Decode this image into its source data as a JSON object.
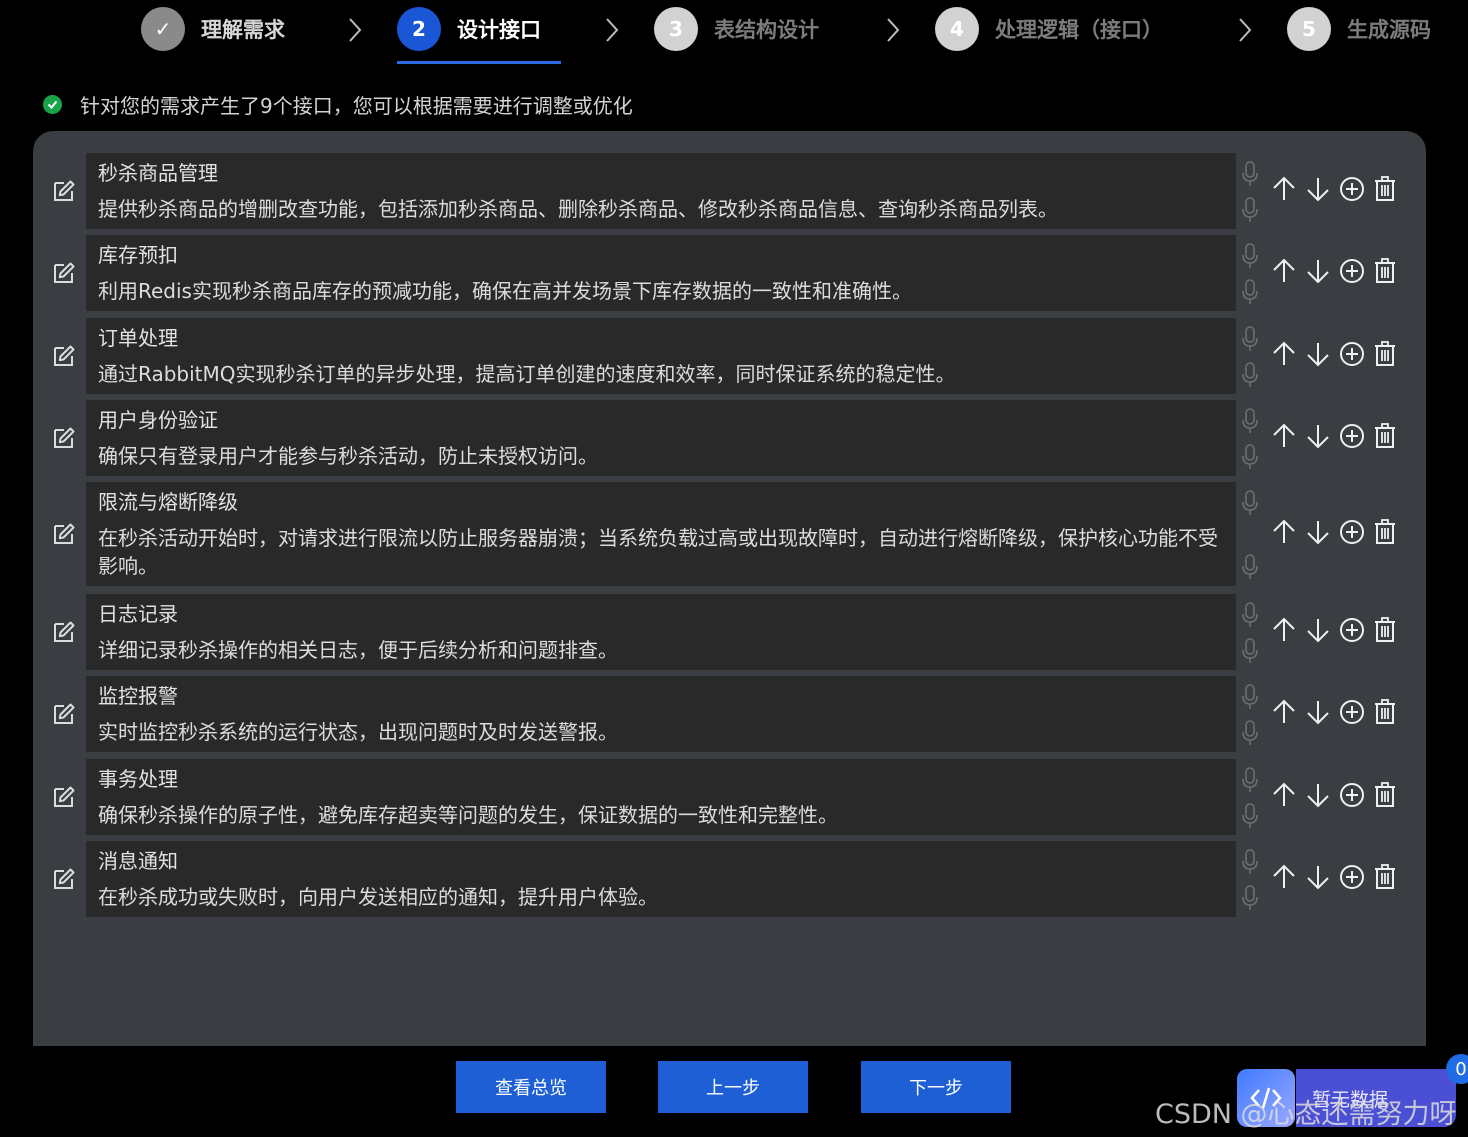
{
  "steps": [
    {
      "num": "✓",
      "label": "理解需求",
      "state": "done"
    },
    {
      "num": "2",
      "label": "设计接口",
      "state": "active"
    },
    {
      "num": "3",
      "label": "表结构设计",
      "state": "todo"
    },
    {
      "num": "4",
      "label": "处理逻辑（接口）",
      "state": "todo"
    },
    {
      "num": "5",
      "label": "生成源码",
      "state": "todo"
    }
  ],
  "info_text": "针对您的需求产生了9个接口，您可以根据需要进行调整或优化",
  "interfaces": [
    {
      "title": "秒杀商品管理",
      "desc": "提供秒杀商品的增删改查功能，包括添加秒杀商品、删除秒杀商品、修改秒杀商品信息、查询秒杀商品列表。"
    },
    {
      "title": "库存预扣",
      "desc": "利用Redis实现秒杀商品库存的预减功能，确保在高并发场景下库存数据的一致性和准确性。"
    },
    {
      "title": "订单处理",
      "desc": "通过RabbitMQ实现秒杀订单的异步处理，提高订单创建的速度和效率，同时保证系统的稳定性。"
    },
    {
      "title": "用户身份验证",
      "desc": "确保只有登录用户才能参与秒杀活动，防止未授权访问。"
    },
    {
      "title": "限流与熔断降级",
      "desc": "在秒杀活动开始时，对请求进行限流以防止服务器崩溃；当系统负载过高或出现故障时，自动进行熔断降级，保护核心功能不受影响。"
    },
    {
      "title": "日志记录",
      "desc": "详细记录秒杀操作的相关日志，便于后续分析和问题排查。"
    },
    {
      "title": "监控报警",
      "desc": "实时监控秒杀系统的运行状态，出现问题时及时发送警报。"
    },
    {
      "title": "事务处理",
      "desc": "确保秒杀操作的原子性，避免库存超卖等问题的发生，保证数据的一致性和完整性。"
    },
    {
      "title": "消息通知",
      "desc": "在秒杀成功或失败时，向用户发送相应的通知，提升用户体验。"
    }
  ],
  "buttons": {
    "overview": "查看总览",
    "prev": "上一步",
    "next": "下一步"
  },
  "float_tag": "暂无数据",
  "badge": "0",
  "watermark": "CSDN @心态还需努力呀",
  "colors": {
    "accent": "#1e5fd6",
    "success": "#1aa34a",
    "panel": "#3a3d41",
    "card": "#292929"
  }
}
